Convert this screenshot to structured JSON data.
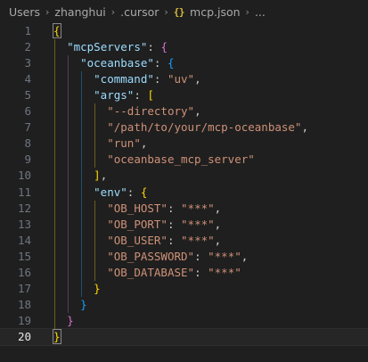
{
  "breadcrumb": {
    "items": [
      "Users",
      "zhanghui",
      ".cursor",
      "mcp.json",
      "..."
    ],
    "file_icon_glyph": "{}",
    "separator_glyph": "›"
  },
  "editor": {
    "current_line": 20,
    "lines": [
      {
        "n": "1",
        "tokens": [
          {
            "t": "{",
            "c": "b1"
          }
        ]
      },
      {
        "n": "2",
        "tokens": [
          {
            "t": "  ",
            "c": "p"
          },
          {
            "t": "\"mcpServers\"",
            "c": "key"
          },
          {
            "t": ": ",
            "c": "p"
          },
          {
            "t": "{",
            "c": "b2"
          }
        ]
      },
      {
        "n": "3",
        "tokens": [
          {
            "t": "    ",
            "c": "p"
          },
          {
            "t": "\"oceanbase\"",
            "c": "key"
          },
          {
            "t": ": ",
            "c": "p"
          },
          {
            "t": "{",
            "c": "b3"
          }
        ]
      },
      {
        "n": "4",
        "tokens": [
          {
            "t": "      ",
            "c": "p"
          },
          {
            "t": "\"command\"",
            "c": "key"
          },
          {
            "t": ": ",
            "c": "p"
          },
          {
            "t": "\"uv\"",
            "c": "str"
          },
          {
            "t": ",",
            "c": "p"
          }
        ]
      },
      {
        "n": "5",
        "tokens": [
          {
            "t": "      ",
            "c": "p"
          },
          {
            "t": "\"args\"",
            "c": "key"
          },
          {
            "t": ": ",
            "c": "p"
          },
          {
            "t": "[",
            "c": "b1"
          }
        ]
      },
      {
        "n": "6",
        "tokens": [
          {
            "t": "        ",
            "c": "p"
          },
          {
            "t": "\"--directory\"",
            "c": "str"
          },
          {
            "t": ",",
            "c": "p"
          }
        ]
      },
      {
        "n": "7",
        "tokens": [
          {
            "t": "        ",
            "c": "p"
          },
          {
            "t": "\"/path/to/your/mcp-oceanbase\"",
            "c": "str"
          },
          {
            "t": ",",
            "c": "p"
          }
        ]
      },
      {
        "n": "8",
        "tokens": [
          {
            "t": "        ",
            "c": "p"
          },
          {
            "t": "\"run\"",
            "c": "str"
          },
          {
            "t": ",",
            "c": "p"
          }
        ]
      },
      {
        "n": "9",
        "tokens": [
          {
            "t": "        ",
            "c": "p"
          },
          {
            "t": "\"oceanbase_mcp_server\"",
            "c": "str"
          }
        ]
      },
      {
        "n": "10",
        "tokens": [
          {
            "t": "      ",
            "c": "p"
          },
          {
            "t": "]",
            "c": "b1"
          },
          {
            "t": ",",
            "c": "p"
          }
        ]
      },
      {
        "n": "11",
        "tokens": [
          {
            "t": "      ",
            "c": "p"
          },
          {
            "t": "\"env\"",
            "c": "key"
          },
          {
            "t": ": ",
            "c": "p"
          },
          {
            "t": "{",
            "c": "b1"
          }
        ]
      },
      {
        "n": "12",
        "tokens": [
          {
            "t": "        ",
            "c": "p"
          },
          {
            "t": "\"OB_HOST\"",
            "c": "str"
          },
          {
            "t": ": ",
            "c": "p"
          },
          {
            "t": "\"***\"",
            "c": "str"
          },
          {
            "t": ",",
            "c": "p"
          }
        ]
      },
      {
        "n": "13",
        "tokens": [
          {
            "t": "        ",
            "c": "p"
          },
          {
            "t": "\"OB_PORT\"",
            "c": "str"
          },
          {
            "t": ": ",
            "c": "p"
          },
          {
            "t": "\"***\"",
            "c": "str"
          },
          {
            "t": ",",
            "c": "p"
          }
        ]
      },
      {
        "n": "14",
        "tokens": [
          {
            "t": "        ",
            "c": "p"
          },
          {
            "t": "\"OB_USER\"",
            "c": "str"
          },
          {
            "t": ": ",
            "c": "p"
          },
          {
            "t": "\"***\"",
            "c": "str"
          },
          {
            "t": ",",
            "c": "p"
          }
        ]
      },
      {
        "n": "15",
        "tokens": [
          {
            "t": "        ",
            "c": "p"
          },
          {
            "t": "\"OB_PASSWORD\"",
            "c": "str"
          },
          {
            "t": ": ",
            "c": "p"
          },
          {
            "t": "\"***\"",
            "c": "str"
          },
          {
            "t": ",",
            "c": "p"
          }
        ]
      },
      {
        "n": "16",
        "tokens": [
          {
            "t": "        ",
            "c": "p"
          },
          {
            "t": "\"OB_DATABASE\"",
            "c": "str"
          },
          {
            "t": ": ",
            "c": "p"
          },
          {
            "t": "\"***\"",
            "c": "str"
          }
        ]
      },
      {
        "n": "17",
        "tokens": [
          {
            "t": "      ",
            "c": "p"
          },
          {
            "t": "}",
            "c": "b1"
          }
        ]
      },
      {
        "n": "18",
        "tokens": [
          {
            "t": "    ",
            "c": "p"
          },
          {
            "t": "}",
            "c": "b3"
          }
        ]
      },
      {
        "n": "19",
        "tokens": [
          {
            "t": "  ",
            "c": "p"
          },
          {
            "t": "}",
            "c": "b2"
          }
        ]
      },
      {
        "n": "20",
        "tokens": [
          {
            "t": "}",
            "c": "b1"
          }
        ]
      }
    ]
  },
  "colors": {
    "background": "#1f1f1f",
    "key": "#9cdcfe",
    "string": "#ce9178",
    "bracket_gold": "#ffd700",
    "bracket_pink": "#da70d6",
    "bracket_blue": "#179fff",
    "line_number": "#6e7681"
  }
}
